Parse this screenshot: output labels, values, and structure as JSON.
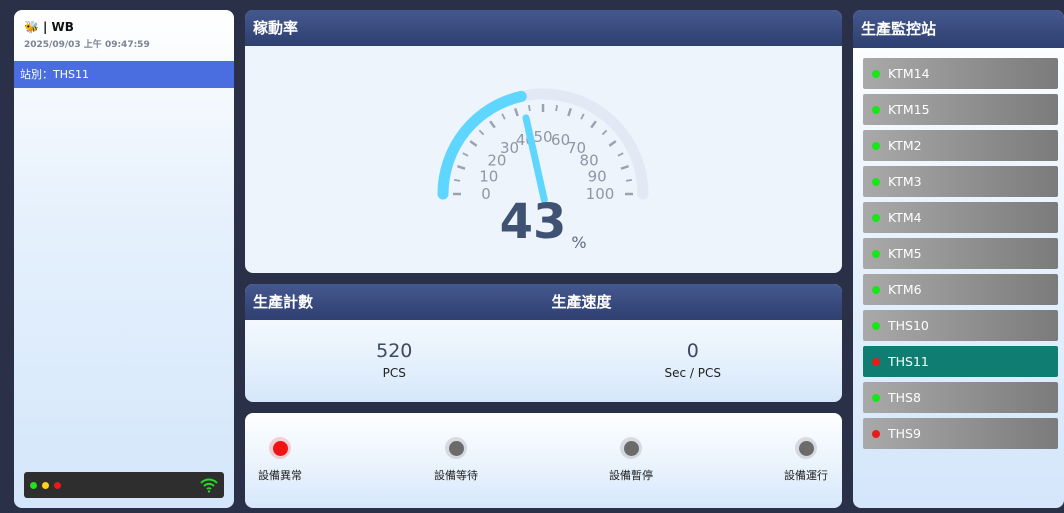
{
  "header": {
    "logo_icon": "bee-icon",
    "brand": "| WB",
    "datetime": "2025/09/03 上午 09:47:59"
  },
  "left": {
    "station_label": "站別：THS11",
    "lights": [
      "#22e022",
      "#ffd21a",
      "#e81a1a"
    ],
    "signal_icon": "wifi-icon"
  },
  "gauge": {
    "title": "稼動率",
    "value": 43,
    "unit": "%",
    "min": 0,
    "max": 100,
    "tick_labels": [
      "0",
      "10",
      "20",
      "30",
      "40",
      "50",
      "60",
      "70",
      "80",
      "90",
      "100"
    ],
    "arc_color": "#5ed6ff"
  },
  "production": {
    "count_title": "生產計數",
    "speed_title": "生產速度",
    "count_value": "520",
    "count_unit": "PCS",
    "speed_value": "0",
    "speed_unit": "Sec / PCS"
  },
  "status_indicators": [
    {
      "label": "設備異常",
      "color": "#f01414"
    },
    {
      "label": "設備等待",
      "color": "#6b6b6b"
    },
    {
      "label": "設備暫停",
      "color": "#6b6b6b"
    },
    {
      "label": "設備運行",
      "color": "#6b6b6b"
    }
  ],
  "stations": {
    "title": "生產監控站",
    "items": [
      {
        "name": "KTM14",
        "status_color": "#19e619",
        "active": false
      },
      {
        "name": "KTM15",
        "status_color": "#19e619",
        "active": false
      },
      {
        "name": "KTM2",
        "status_color": "#19e619",
        "active": false
      },
      {
        "name": "KTM3",
        "status_color": "#19e619",
        "active": false
      },
      {
        "name": "KTM4",
        "status_color": "#19e619",
        "active": false
      },
      {
        "name": "KTM5",
        "status_color": "#19e619",
        "active": false
      },
      {
        "name": "KTM6",
        "status_color": "#19e619",
        "active": false
      },
      {
        "name": "THS10",
        "status_color": "#19e619",
        "active": false
      },
      {
        "name": "THS11",
        "status_color": "#e81a1a",
        "active": true
      },
      {
        "name": "THS8",
        "status_color": "#19e619",
        "active": false
      },
      {
        "name": "THS9",
        "status_color": "#e81a1a",
        "active": false
      }
    ]
  }
}
